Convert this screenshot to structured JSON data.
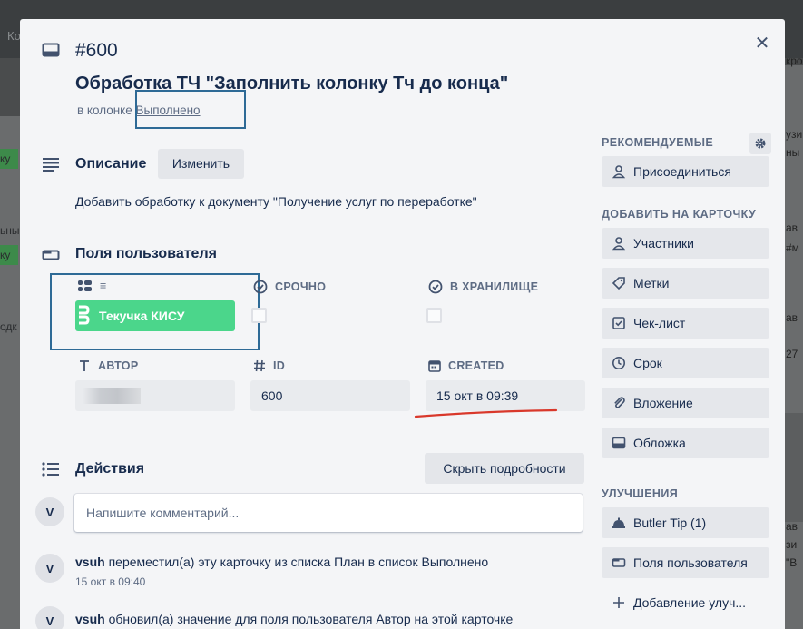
{
  "background": {
    "top_label": "Ко",
    "left_fragments": [
      "ку",
      "ьны",
      "ку",
      "одк"
    ],
    "right_fragments": [
      "кроп",
      "узи",
      "ны",
      "ав",
      "#м",
      "ав",
      "27",
      "зд",
      "ав",
      "зи",
      "\"В"
    ]
  },
  "card": {
    "number": "#600",
    "title": "Обработка ТЧ \"Заполнить колонку Тч до конца\"",
    "in_list_prefix": "в колонке",
    "list_name": "Выполнено"
  },
  "description": {
    "title": "Описание",
    "edit_label": "Изменить",
    "text": "Добавить обработку к документу \"Получение услуг по переработке\""
  },
  "custom_fields": {
    "title": "Поля пользователя",
    "list_field_label": "≡",
    "list_field_value": "Текучка КИСУ",
    "urgent_label": "СРОЧНО",
    "storage_label": "В ХРАНИЛИЩЕ",
    "author_label": "АВТОР",
    "id_label": "ID",
    "id_value": "600",
    "created_label": "CREATED",
    "created_value": "15 окт в 09:39"
  },
  "activity": {
    "title": "Действия",
    "toggle_label": "Скрыть подробности",
    "comment_placeholder": "Напишите комментарий...",
    "avatar_initial": "V",
    "items": [
      {
        "user": "vsuh",
        "text": "переместил(а) эту карточку из списка План в список Выполнено",
        "time": "15 окт в 09:40"
      },
      {
        "user": "vsuh",
        "text": "обновил(а) значение для поля пользователя Автор на этой карточке",
        "time": ""
      }
    ]
  },
  "sidebar": {
    "suggested_title": "РЕКОМЕНДУЕМЫЕ",
    "join_label": "Присоединиться",
    "add_title": "ДОБАВИТЬ НА КАРТОЧКУ",
    "add_items": [
      "Участники",
      "Метки",
      "Чек-лист",
      "Срок",
      "Вложение",
      "Обложка"
    ],
    "powerups_title": "УЛУЧШЕНИЯ",
    "powerup_items": [
      "Butler Tip (1)",
      "Поля пользователя",
      "Добавление улуч..."
    ]
  },
  "colors": {
    "list_field_green": "#4bd68b",
    "highlight_box": "#2e6a96",
    "annotation_red": "#d9382b"
  }
}
